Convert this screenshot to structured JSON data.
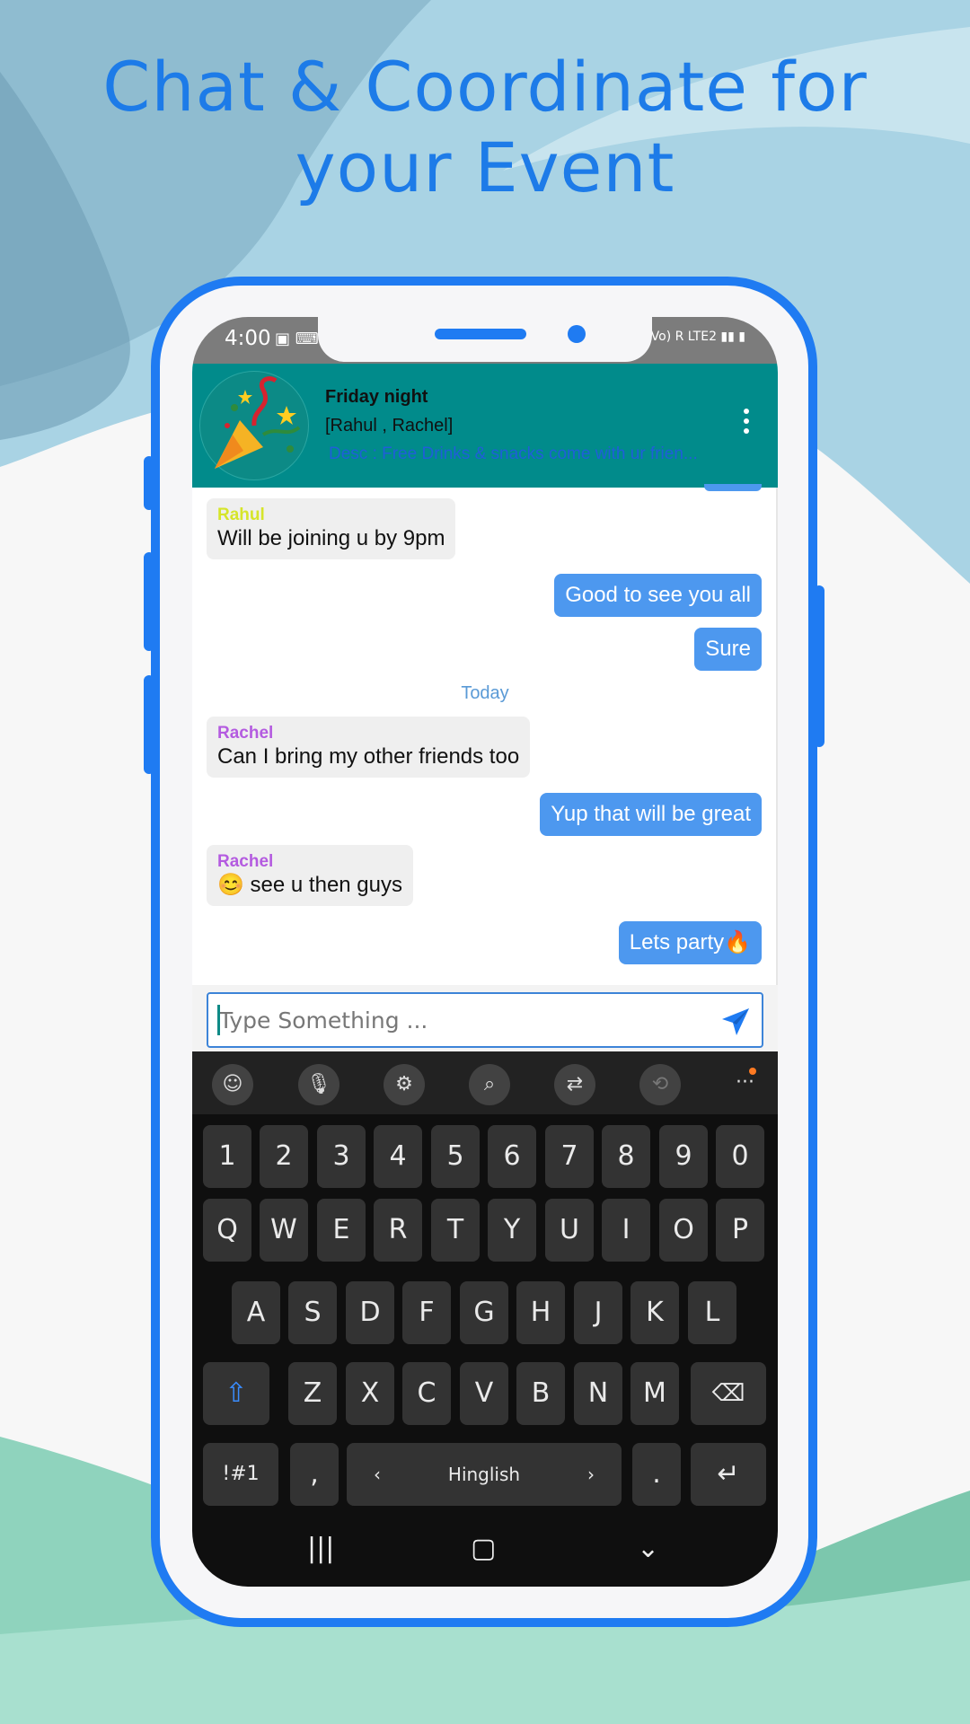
{
  "headline": {
    "line1": "Chat & Coordinate for",
    "line2": "your Event"
  },
  "colors": {
    "accent": "#1f7bf2",
    "header": "#018b8b",
    "bubble_out": "#4d98ef",
    "bubble_in": "#efefef"
  },
  "status": {
    "time": "4:00",
    "left_icons": "notification-icons",
    "right": "Vo) R LTE2"
  },
  "chat": {
    "title": "Friday night",
    "members": "[Rahul , Rachel]",
    "description": "Desc : Free Drinks & snacks come with ur frien...",
    "avatar_icon": "party-popper-icon",
    "menu_icon": "more-vert-icon"
  },
  "messages": [
    {
      "dir": "in",
      "sender": "Rahul",
      "sender_color": "#d6e52a",
      "text": "Will be joining u by 9pm"
    },
    {
      "dir": "out",
      "text": "Good to see you all"
    },
    {
      "dir": "out",
      "text": "Sure"
    },
    {
      "dir": "sep",
      "text": "Today"
    },
    {
      "dir": "in",
      "sender": "Rachel",
      "sender_color": "#b45be0",
      "text": "Can I bring my other friends too"
    },
    {
      "dir": "out",
      "text": "Yup that will be great"
    },
    {
      "dir": "in",
      "sender": "Rachel",
      "sender_color": "#b45be0",
      "text": "😊 see u then guys"
    },
    {
      "dir": "out",
      "text": "Lets party🔥"
    }
  ],
  "composer": {
    "placeholder": "Type Something ...",
    "send_icon": "send-icon"
  },
  "keyboard": {
    "toolbar": [
      "emoji-icon",
      "mic-icon",
      "settings-icon",
      "search-icon",
      "translate-icon",
      "sync-icon",
      "more-icon"
    ],
    "row_numbers": [
      "1",
      "2",
      "3",
      "4",
      "5",
      "6",
      "7",
      "8",
      "9",
      "0"
    ],
    "row1": [
      "Q",
      "W",
      "E",
      "R",
      "T",
      "Y",
      "U",
      "I",
      "O",
      "P"
    ],
    "row2": [
      "A",
      "S",
      "D",
      "F",
      "G",
      "H",
      "J",
      "K",
      "L"
    ],
    "row3": [
      "Z",
      "X",
      "C",
      "V",
      "B",
      "N",
      "M"
    ],
    "symbols": "!#1",
    "comma": ",",
    "space_label": "Hinglish",
    "period": ".",
    "shift_icon": "shift-icon",
    "backspace_icon": "backspace-icon",
    "enter_icon": "enter-icon"
  },
  "navbar": [
    "recents-icon",
    "home-icon",
    "back-icon"
  ]
}
